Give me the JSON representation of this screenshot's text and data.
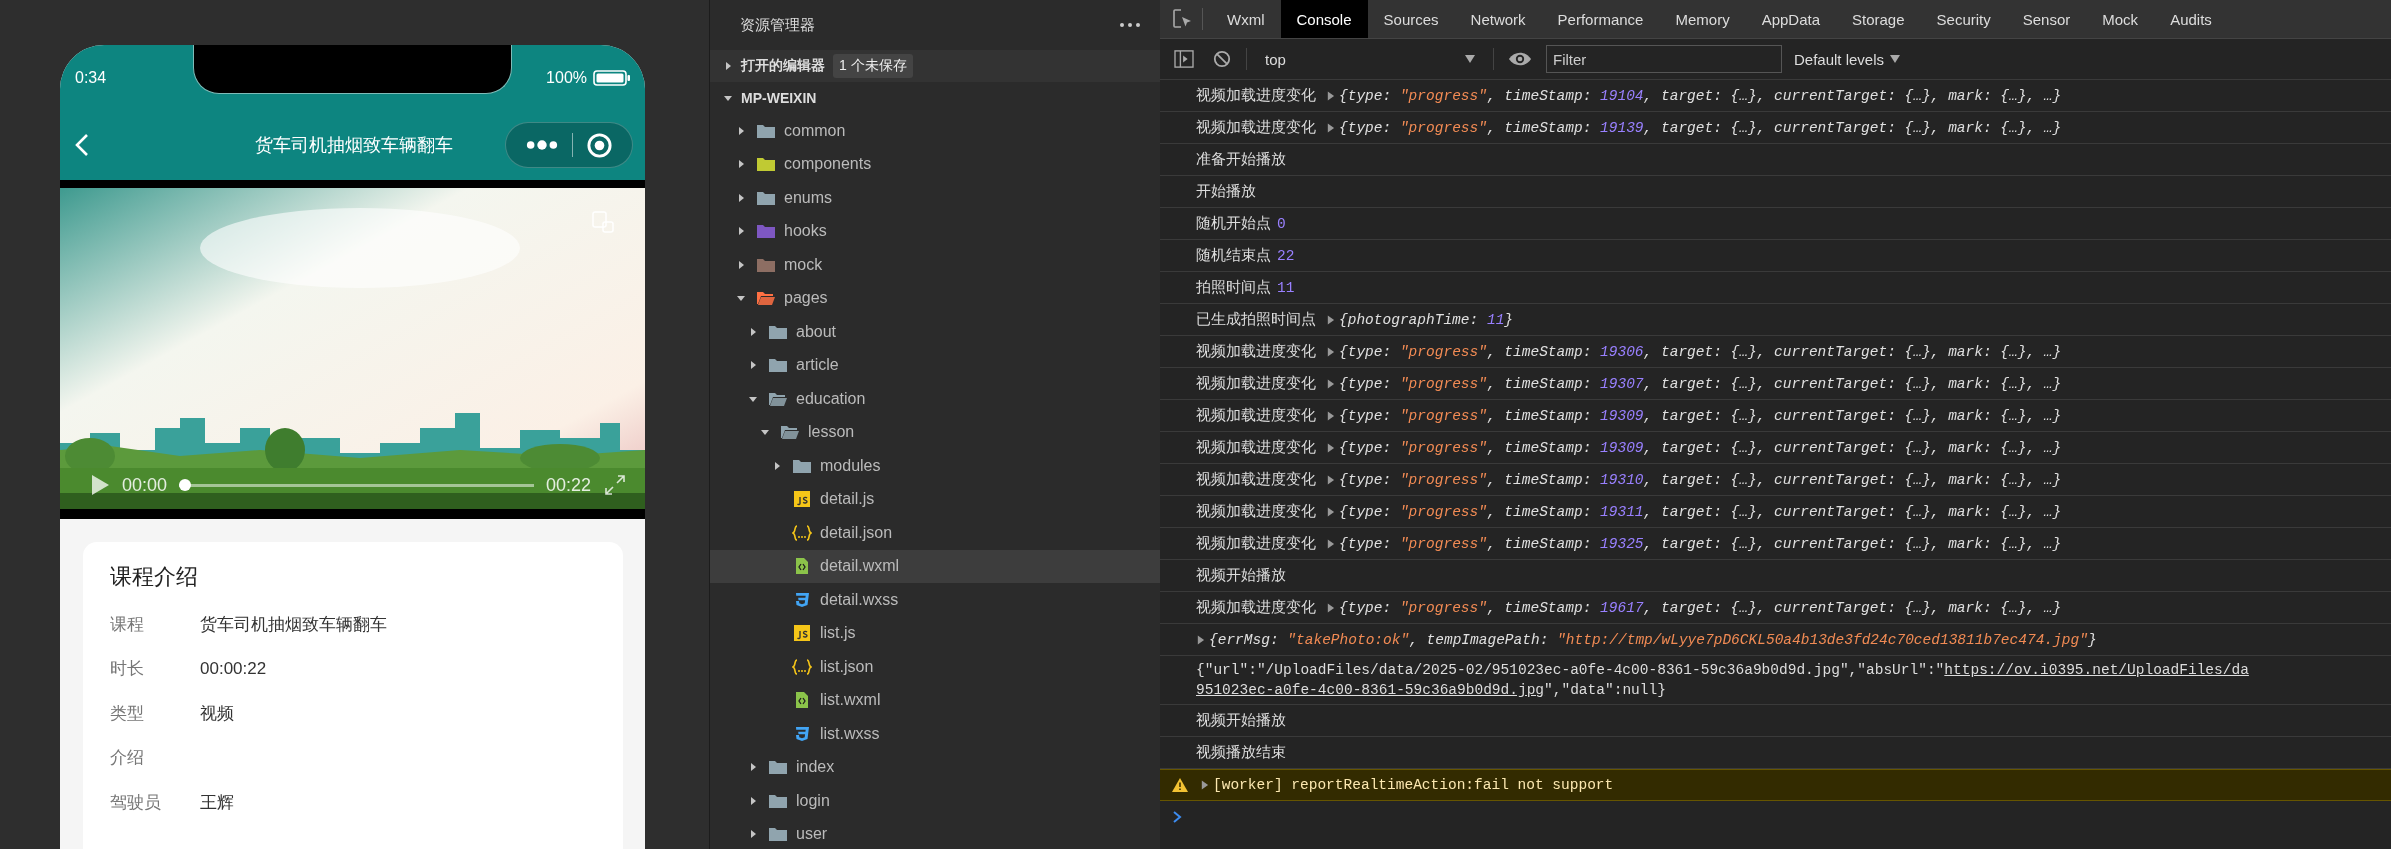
{
  "phone": {
    "status": {
      "time": "0:34",
      "battery": "100%"
    },
    "nav": {
      "title": "货车司机抽烟致车辆翻车"
    },
    "video": {
      "current": "00:00",
      "duration": "00:22",
      "level": 0
    },
    "card": {
      "title": "课程介绍",
      "rows": [
        {
          "label": "课程",
          "value": "货车司机抽烟致车辆翻车"
        },
        {
          "label": "时长",
          "value": "00:00:22"
        },
        {
          "label": "类型",
          "value": "视频"
        },
        {
          "label": "介绍"
        },
        {
          "label": "驾驶员",
          "value": "王辉"
        }
      ]
    }
  },
  "explorer": {
    "title": "资源管理器",
    "sections": [
      {
        "label": "打开的编辑器",
        "expanded": false,
        "badge": "1 个未保存"
      },
      {
        "label": "MP-WEIXIN",
        "expanded": true
      }
    ],
    "tree": [
      {
        "name": "common",
        "kind": "folder",
        "color": "#90a4ae",
        "expanded": false,
        "selected": false
      },
      {
        "name": "components",
        "kind": "folder",
        "color": "#c0ca33",
        "expanded": false,
        "selected": false
      },
      {
        "name": "enums",
        "kind": "folder",
        "color": "#90a4ae",
        "expanded": false,
        "selected": false
      },
      {
        "name": "hooks",
        "kind": "folder",
        "color": "#7e57c2",
        "expanded": false,
        "selected": false
      },
      {
        "name": "mock",
        "kind": "folder",
        "color": "#8d6e63",
        "expanded": false,
        "selected": false
      },
      {
        "name": "pages",
        "kind": "folder",
        "color": "#ff7043",
        "expanded": true,
        "selected": false,
        "children": [
          {
            "name": "about",
            "kind": "folder",
            "color": "#90a4ae",
            "expanded": false,
            "selected": false
          },
          {
            "name": "article",
            "kind": "folder",
            "color": "#90a4ae",
            "expanded": false,
            "selected": false
          },
          {
            "name": "education",
            "kind": "folder",
            "color": "#90a4ae",
            "expanded": true,
            "selected": false,
            "children": [
              {
                "name": "lesson",
                "kind": "folder",
                "color": "#90a4ae",
                "expanded": true,
                "selected": false,
                "children": [
                  {
                    "name": "modules",
                    "kind": "folder",
                    "color": "#90a4ae",
                    "expanded": false,
                    "selected": false
                  },
                  {
                    "name": "detail.js",
                    "kind": "js",
                    "selected": false
                  },
                  {
                    "name": "detail.json",
                    "kind": "json",
                    "selected": false
                  },
                  {
                    "name": "detail.wxml",
                    "kind": "wxml",
                    "selected": true
                  },
                  {
                    "name": "detail.wxss",
                    "kind": "wxss",
                    "selected": false
                  },
                  {
                    "name": "list.js",
                    "kind": "js",
                    "selected": false
                  },
                  {
                    "name": "list.json",
                    "kind": "json",
                    "selected": false
                  },
                  {
                    "name": "list.wxml",
                    "kind": "wxml",
                    "selected": false
                  },
                  {
                    "name": "list.wxss",
                    "kind": "wxss",
                    "selected": false
                  }
                ]
              }
            ]
          },
          {
            "name": "index",
            "kind": "folder",
            "color": "#90a4ae",
            "expanded": false,
            "selected": false
          },
          {
            "name": "login",
            "kind": "folder",
            "color": "#90a4ae",
            "expanded": false,
            "selected": false
          },
          {
            "name": "user",
            "kind": "folder",
            "color": "#90a4ae",
            "expanded": false,
            "selected": false
          }
        ]
      }
    ]
  },
  "devtools": {
    "tabs": [
      {
        "label": "Wxml",
        "selected": false
      },
      {
        "label": "Console",
        "selected": true
      },
      {
        "label": "Sources",
        "selected": false
      },
      {
        "label": "Network",
        "selected": false
      },
      {
        "label": "Performance",
        "selected": false
      },
      {
        "label": "Memory",
        "selected": false
      },
      {
        "label": "AppData",
        "selected": false
      },
      {
        "label": "Storage",
        "selected": false
      },
      {
        "label": "Security",
        "selected": false
      },
      {
        "label": "Sensor",
        "selected": false
      },
      {
        "label": "Mock",
        "selected": false
      },
      {
        "label": "Audits",
        "selected": false
      }
    ],
    "toolbar": {
      "context": "top",
      "filter_placeholder": "Filter",
      "levels": "Default levels"
    },
    "console": [
      {
        "kind": "object",
        "message": "视频加载进度变化",
        "tokens": [
          {
            "plain": "{type: "
          },
          {
            "string": "\"progress\""
          },
          {
            "plain": ", timeStamp: "
          },
          {
            "number": "19104"
          },
          {
            "plain": ", target: {…}, currentTarget: {…}, mark: {…}, …}"
          }
        ]
      },
      {
        "kind": "object",
        "message": "视频加载进度变化",
        "tokens": [
          {
            "plain": "{type: "
          },
          {
            "string": "\"progress\""
          },
          {
            "plain": ", timeStamp: "
          },
          {
            "number": "19139"
          },
          {
            "plain": ", target: {…}, currentTarget: {…}, mark: {…}, …}"
          }
        ]
      },
      {
        "kind": "text",
        "message": "准备开始播放"
      },
      {
        "kind": "text",
        "message": "开始播放"
      },
      {
        "kind": "number",
        "message": "随机开始点",
        "value": "0"
      },
      {
        "kind": "number",
        "message": "随机结束点",
        "value": "22"
      },
      {
        "kind": "number",
        "message": "拍照时间点",
        "value": "11"
      },
      {
        "kind": "object",
        "message": "已生成拍照时间点",
        "tokens": [
          {
            "plain": "{photographTime: "
          },
          {
            "number": "11"
          },
          {
            "plain": "}"
          }
        ]
      },
      {
        "kind": "object",
        "message": "视频加载进度变化",
        "tokens": [
          {
            "plain": "{type: "
          },
          {
            "string": "\"progress\""
          },
          {
            "plain": ", timeStamp: "
          },
          {
            "number": "19306"
          },
          {
            "plain": ", target: {…}, currentTarget: {…}, mark: {…}, …}"
          }
        ]
      },
      {
        "kind": "object",
        "message": "视频加载进度变化",
        "tokens": [
          {
            "plain": "{type: "
          },
          {
            "string": "\"progress\""
          },
          {
            "plain": ", timeStamp: "
          },
          {
            "number": "19307"
          },
          {
            "plain": ", target: {…}, currentTarget: {…}, mark: {…}, …}"
          }
        ]
      },
      {
        "kind": "object",
        "message": "视频加载进度变化",
        "tokens": [
          {
            "plain": "{type: "
          },
          {
            "string": "\"progress\""
          },
          {
            "plain": ", timeStamp: "
          },
          {
            "number": "19309"
          },
          {
            "plain": ", target: {…}, currentTarget: {…}, mark: {…}, …}"
          }
        ]
      },
      {
        "kind": "object",
        "message": "视频加载进度变化",
        "tokens": [
          {
            "plain": "{type: "
          },
          {
            "string": "\"progress\""
          },
          {
            "plain": ", timeStamp: "
          },
          {
            "number": "19309"
          },
          {
            "plain": ", target: {…}, currentTarget: {…}, mark: {…}, …}"
          }
        ]
      },
      {
        "kind": "object",
        "message": "视频加载进度变化",
        "tokens": [
          {
            "plain": "{type: "
          },
          {
            "string": "\"progress\""
          },
          {
            "plain": ", timeStamp: "
          },
          {
            "number": "19310"
          },
          {
            "plain": ", target: {…}, currentTarget: {…}, mark: {…}, …}"
          }
        ]
      },
      {
        "kind": "object",
        "message": "视频加载进度变化",
        "tokens": [
          {
            "plain": "{type: "
          },
          {
            "string": "\"progress\""
          },
          {
            "plain": ", timeStamp: "
          },
          {
            "number": "19311"
          },
          {
            "plain": ", target: {…}, currentTarget: {…}, mark: {…}, …}"
          }
        ]
      },
      {
        "kind": "object",
        "message": "视频加载进度变化",
        "tokens": [
          {
            "plain": "{type: "
          },
          {
            "string": "\"progress\""
          },
          {
            "plain": ", timeStamp: "
          },
          {
            "number": "19325"
          },
          {
            "plain": ", target: {…}, currentTarget: {…}, mark: {…}, …}"
          }
        ]
      },
      {
        "kind": "text",
        "message": "视频开始播放"
      },
      {
        "kind": "object",
        "message": "视频加载进度变化",
        "tokens": [
          {
            "plain": "{type: "
          },
          {
            "string": "\"progress\""
          },
          {
            "plain": ", timeStamp: "
          },
          {
            "number": "19617"
          },
          {
            "plain": ", target: {…}, currentTarget: {…}, mark: {…}, …}"
          }
        ]
      },
      {
        "kind": "object",
        "tokens": [
          {
            "plain": "{errMsg: "
          },
          {
            "string": "\"takePhoto:ok\""
          },
          {
            "plain": ", tempImagePath: "
          },
          {
            "string": "\"http://tmp/wLyye7pD6CKL50a4b13de3fd24c70ced13811b7ec474.jpg\""
          },
          {
            "plain": "}"
          }
        ]
      },
      {
        "kind": "wrapped",
        "lines": [
          [
            {
              "plain": "{\"url\":\"/UploadFiles/data/2025-02/951023ec-a0fe-4c00-8361-59c36a9b0d9d.jpg\",\"absUrl\":\""
            },
            {
              "link": "https://ov.i0395.net/UploadFiles/da"
            }
          ],
          [
            {
              "link": "951023ec-a0fe-4c00-8361-59c36a9b0d9d.jpg"
            },
            {
              "plain": "\",\"data\":null}"
            }
          ]
        ]
      },
      {
        "kind": "text",
        "message": "视频开始播放"
      },
      {
        "kind": "text",
        "message": "视频播放结束"
      },
      {
        "kind": "warning",
        "message": "[worker] reportRealtimeAction:fail not support"
      },
      {
        "kind": "prompt"
      }
    ]
  }
}
